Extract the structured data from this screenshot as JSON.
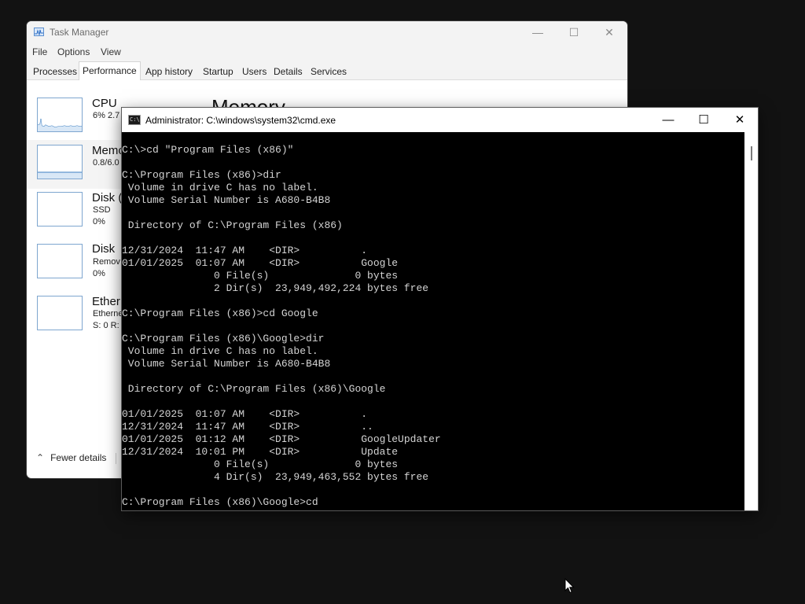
{
  "task_manager": {
    "title": "Task Manager",
    "menu": [
      "File",
      "Options",
      "View"
    ],
    "tabs": [
      "Processes",
      "Performance",
      "App history",
      "Startup",
      "Users",
      "Details",
      "Services"
    ],
    "active_tab": "Performance",
    "perf_items": [
      {
        "name": "CPU",
        "sub1": "6%  2.7"
      },
      {
        "name": "Memo",
        "sub1": "0.8/6.0"
      },
      {
        "name": "Disk (",
        "sub1": "SSD",
        "sub2": "0%"
      },
      {
        "name": "Disk",
        "sub1": "Remov",
        "sub2": "0%"
      },
      {
        "name": "Ether",
        "sub1": "Etherne",
        "sub2": "S: 0 R:"
      }
    ],
    "section_heading": "Memory",
    "fewer_details": "Fewer details"
  },
  "cmd": {
    "title": "Administrator: C:\\windows\\system32\\cmd.exe",
    "icon_text": "C:\\",
    "lines": [
      "C:\\>cd \"Program Files (x86)\"",
      "",
      "C:\\Program Files (x86)>dir",
      " Volume in drive C has no label.",
      " Volume Serial Number is A680-B4B8",
      "",
      " Directory of C:\\Program Files (x86)",
      "",
      "12/31/2024  11:47 AM    <DIR>          .",
      "01/01/2025  01:07 AM    <DIR>          Google",
      "               0 File(s)              0 bytes",
      "               2 Dir(s)  23,949,492,224 bytes free",
      "",
      "C:\\Program Files (x86)>cd Google",
      "",
      "C:\\Program Files (x86)\\Google>dir",
      " Volume in drive C has no label.",
      " Volume Serial Number is A680-B4B8",
      "",
      " Directory of C:\\Program Files (x86)\\Google",
      "",
      "01/01/2025  01:07 AM    <DIR>          .",
      "12/31/2024  11:47 AM    <DIR>          ..",
      "01/01/2025  01:12 AM    <DIR>          GoogleUpdater",
      "12/31/2024  10:01 PM    <DIR>          Update",
      "               0 File(s)              0 bytes",
      "               4 Dir(s)  23,949,463,552 bytes free",
      "",
      "C:\\Program Files (x86)\\Google>cd"
    ]
  }
}
